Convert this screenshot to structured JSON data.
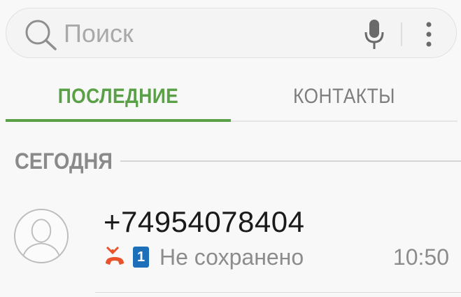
{
  "search": {
    "placeholder": "Поиск",
    "icons": [
      "search-icon",
      "mic-icon",
      "more-vert-icon"
    ]
  },
  "tabs": [
    {
      "label": "ПОСЛЕДНИЕ",
      "selected": true
    },
    {
      "label": "КОНТАКТЫ",
      "selected": false
    }
  ],
  "sections": [
    {
      "header": "СЕГОДНЯ",
      "calls": [
        {
          "number": "+74954078404",
          "type_icon": "missed-call-icon",
          "sim": "1",
          "status": "Не сохранено",
          "time": "10:50",
          "avatar_icon": "person-avatar-icon"
        }
      ]
    }
  ],
  "colors": {
    "accent": "#5aa047",
    "missed_call": "#e8532b",
    "sim_badge": "#1c6fb8",
    "background": "#f8f8f8"
  }
}
